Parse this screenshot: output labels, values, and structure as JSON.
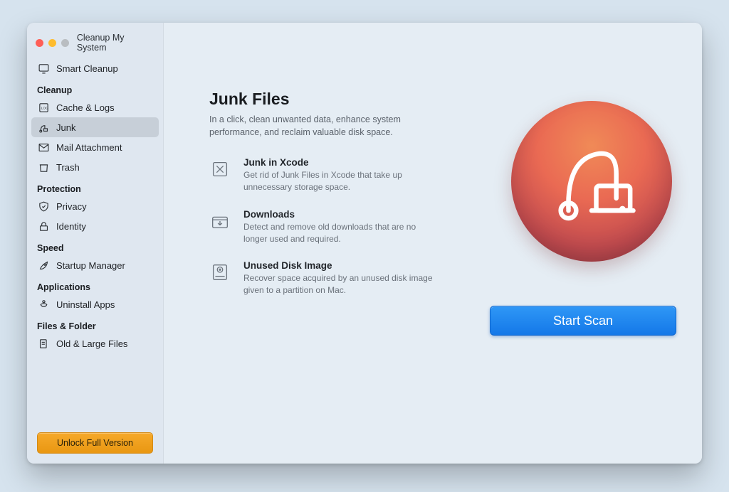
{
  "window": {
    "title": "Cleanup My System"
  },
  "sidebar": {
    "smart": "Smart Cleanup",
    "sections": {
      "cleanup": {
        "head": "Cleanup",
        "items": [
          "Cache & Logs",
          "Junk",
          "Mail Attachment",
          "Trash"
        ]
      },
      "protection": {
        "head": "Protection",
        "items": [
          "Privacy",
          "Identity"
        ]
      },
      "speed": {
        "head": "Speed",
        "items": [
          "Startup Manager"
        ]
      },
      "applications": {
        "head": "Applications",
        "items": [
          "Uninstall Apps"
        ]
      },
      "files": {
        "head": "Files & Folder",
        "items": [
          "Old & Large Files"
        ]
      }
    },
    "unlock": "Unlock Full Version"
  },
  "main": {
    "title": "Junk Files",
    "subtitle": "In a click, clean unwanted data, enhance system performance, and reclaim valuable disk space.",
    "features": [
      {
        "title": "Junk in Xcode",
        "desc": "Get rid of Junk Files in Xcode that take up unnecessary storage space."
      },
      {
        "title": "Downloads",
        "desc": "Detect and remove old downloads that are no longer used and required."
      },
      {
        "title": "Unused Disk Image",
        "desc": "Recover space acquired by an unused disk image given to a partition on Mac."
      }
    ],
    "scan": "Start Scan"
  }
}
